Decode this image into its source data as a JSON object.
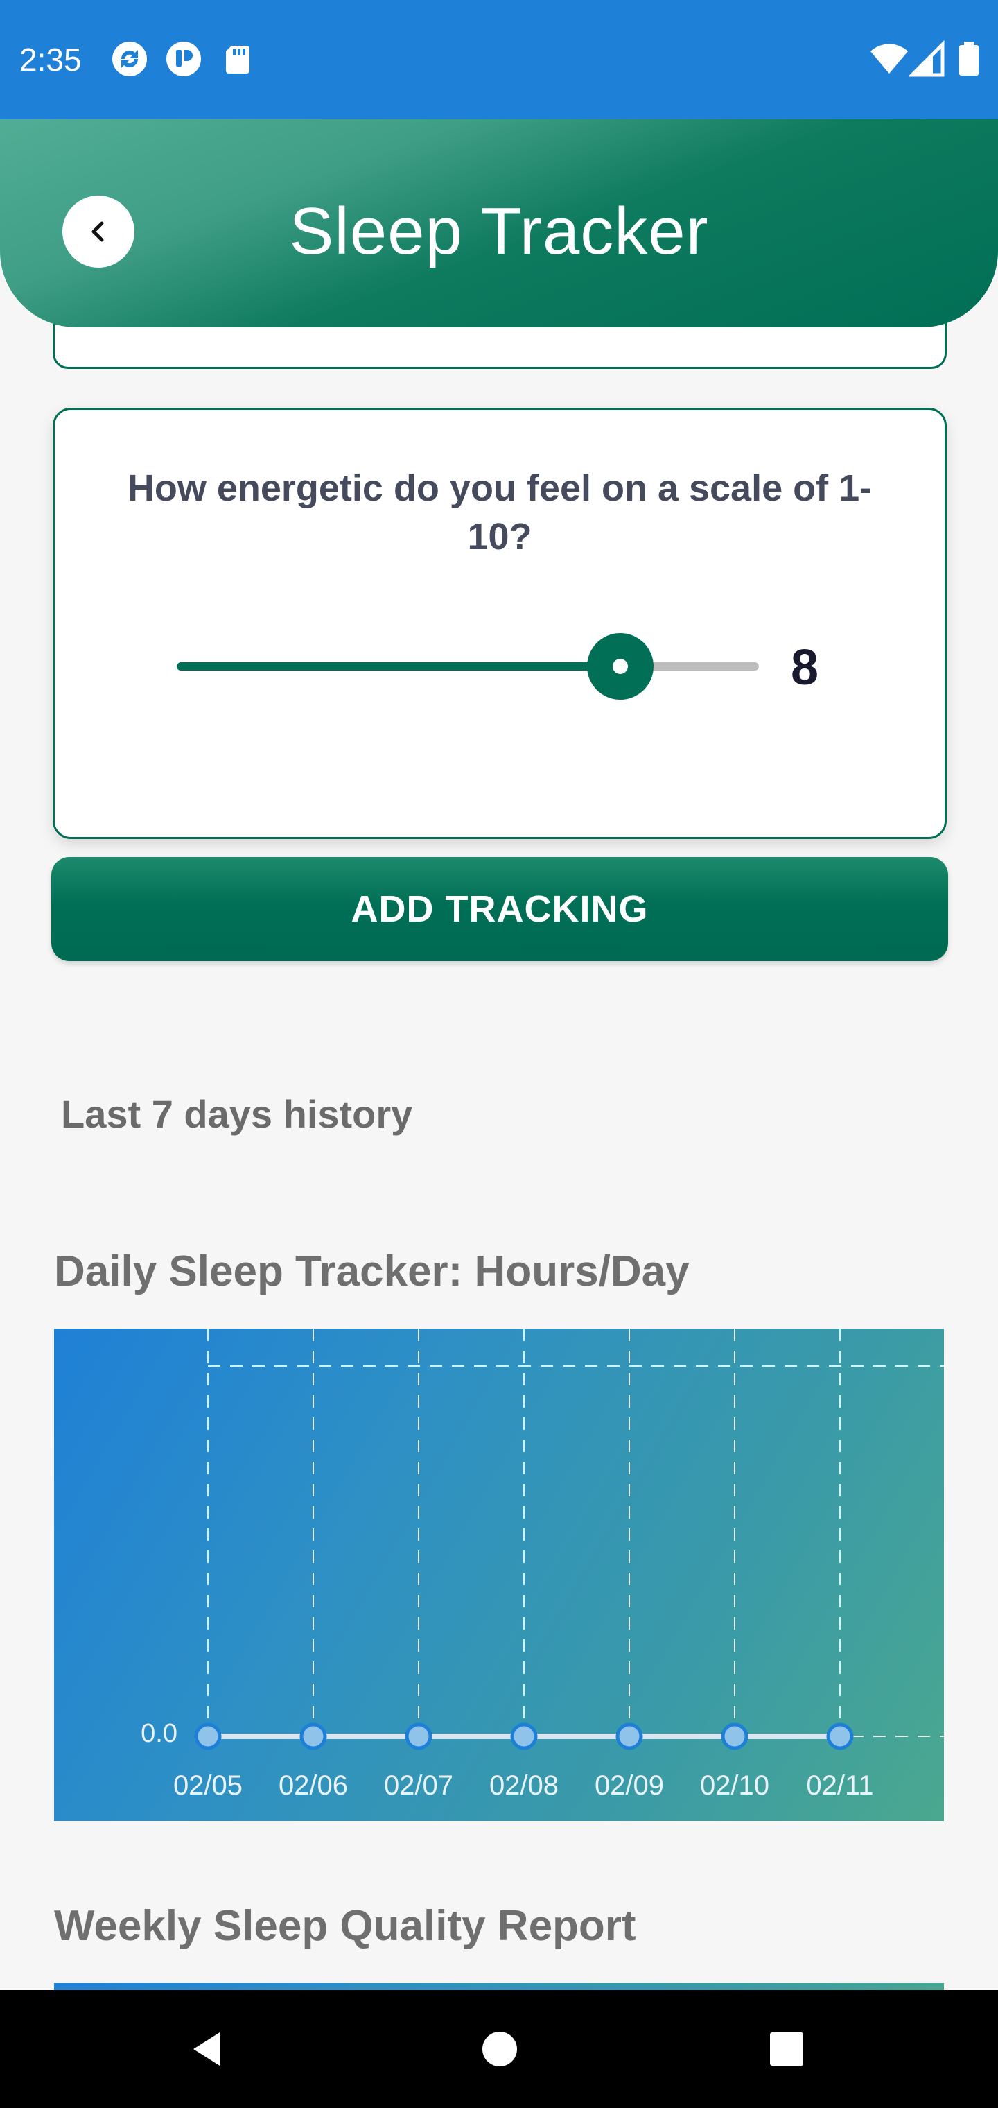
{
  "status_bar": {
    "time": "2:35",
    "left_icons": [
      "sync-icon",
      "app-icon",
      "sd-card-icon"
    ],
    "right_icons": [
      "wifi-icon",
      "signal-icon",
      "battery-icon"
    ]
  },
  "header": {
    "title": "Sleep Tracker",
    "back_icon": "chevron-left-icon"
  },
  "question_card": {
    "question": "How energetic do you feel on a scale of 1-10?",
    "slider": {
      "min": 1,
      "max": 10,
      "value": 8
    },
    "value_label": "8"
  },
  "add_button": {
    "label": "ADD TRACKING"
  },
  "history": {
    "title": "Last 7 days history"
  },
  "charts": {
    "daily": {
      "title": "Daily Sleep Tracker: Hours/Day"
    },
    "weekly": {
      "title": "Weekly Sleep Quality Report"
    }
  },
  "chart_data": [
    {
      "type": "line",
      "title": "Daily Sleep Tracker: Hours/Day",
      "categories": [
        "02/05",
        "02/06",
        "02/07",
        "02/08",
        "02/09",
        "02/10",
        "02/11"
      ],
      "values": [
        0,
        0,
        0,
        0,
        0,
        0,
        0
      ],
      "y_tick_labels": [
        "0.0"
      ],
      "grid": true,
      "colors": {
        "line": "#d9e7f3",
        "point_fill": "#8fc3ea",
        "point_stroke": "#1e7fd6",
        "grid": "#ffffff"
      }
    }
  ],
  "nav_bar": {
    "buttons": [
      "back-triangle-icon",
      "home-circle-icon",
      "recents-square-icon"
    ]
  },
  "colors": {
    "status_bar": "#1e80d6",
    "primary": "#006f55",
    "background": "#f6f6f6"
  }
}
